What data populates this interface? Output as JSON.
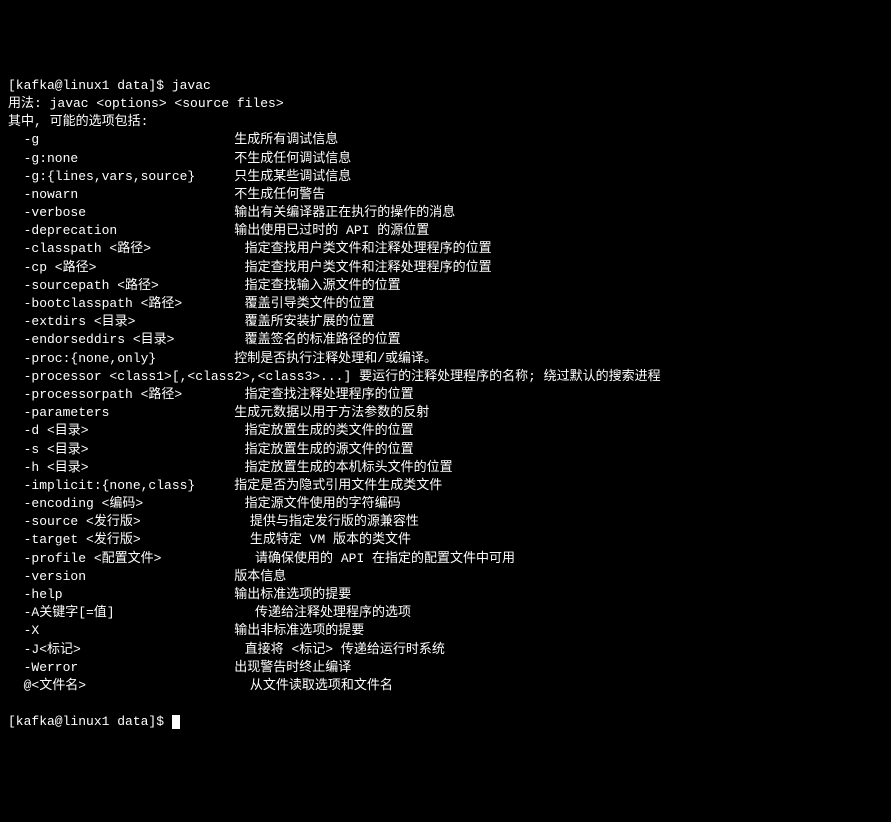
{
  "prompt1": {
    "full": "[kafka@linux1 data]$ ",
    "command": "javac"
  },
  "usage_line": "用法: javac <options> <source files>",
  "header_line": "其中, 可能的选项包括:",
  "options": [
    {
      "flag": "  -g                         ",
      "desc": "生成所有调试信息"
    },
    {
      "flag": "  -g:none                    ",
      "desc": "不生成任何调试信息"
    },
    {
      "flag": "  -g:{lines,vars,source}     ",
      "desc": "只生成某些调试信息"
    },
    {
      "flag": "  -nowarn                    ",
      "desc": "不生成任何警告"
    },
    {
      "flag": "  -verbose                   ",
      "desc": "输出有关编译器正在执行的操作的消息"
    },
    {
      "flag": "  -deprecation               ",
      "desc": "输出使用已过时的 API 的源位置"
    },
    {
      "flag": "  -classpath <路径>            ",
      "desc": "指定查找用户类文件和注释处理程序的位置"
    },
    {
      "flag": "  -cp <路径>                   ",
      "desc": "指定查找用户类文件和注释处理程序的位置"
    },
    {
      "flag": "  -sourcepath <路径>           ",
      "desc": "指定查找输入源文件的位置"
    },
    {
      "flag": "  -bootclasspath <路径>        ",
      "desc": "覆盖引导类文件的位置"
    },
    {
      "flag": "  -extdirs <目录>              ",
      "desc": "覆盖所安装扩展的位置"
    },
    {
      "flag": "  -endorseddirs <目录>         ",
      "desc": "覆盖签名的标准路径的位置"
    },
    {
      "flag": "  -proc:{none,only}          ",
      "desc": "控制是否执行注释处理和/或编译。"
    },
    {
      "flag": "  -processor <class1>[,<class2>,<class3>...] ",
      "desc": "要运行的注释处理程序的名称; 绕过默认的搜索进程"
    },
    {
      "flag": "  -processorpath <路径>        ",
      "desc": "指定查找注释处理程序的位置"
    },
    {
      "flag": "  -parameters                ",
      "desc": "生成元数据以用于方法参数的反射"
    },
    {
      "flag": "  -d <目录>                    ",
      "desc": "指定放置生成的类文件的位置"
    },
    {
      "flag": "  -s <目录>                    ",
      "desc": "指定放置生成的源文件的位置"
    },
    {
      "flag": "  -h <目录>                    ",
      "desc": "指定放置生成的本机标头文件的位置"
    },
    {
      "flag": "  -implicit:{none,class}     ",
      "desc": "指定是否为隐式引用文件生成类文件"
    },
    {
      "flag": "  -encoding <编码>             ",
      "desc": "指定源文件使用的字符编码"
    },
    {
      "flag": "  -source <发行版>              ",
      "desc": "提供与指定发行版的源兼容性"
    },
    {
      "flag": "  -target <发行版>              ",
      "desc": "生成特定 VM 版本的类文件"
    },
    {
      "flag": "  -profile <配置文件>            ",
      "desc": "请确保使用的 API 在指定的配置文件中可用"
    },
    {
      "flag": "  -version                   ",
      "desc": "版本信息"
    },
    {
      "flag": "  -help                      ",
      "desc": "输出标准选项的提要"
    },
    {
      "flag": "  -A关键字[=值]                  ",
      "desc": "传递给注释处理程序的选项"
    },
    {
      "flag": "  -X                         ",
      "desc": "输出非标准选项的提要"
    },
    {
      "flag": "  -J<标记>                     ",
      "desc": "直接将 <标记> 传递给运行时系统"
    },
    {
      "flag": "  -Werror                    ",
      "desc": "出现警告时终止编译"
    },
    {
      "flag": "  @<文件名>                     ",
      "desc": "从文件读取选项和文件名"
    }
  ],
  "prompt2": {
    "full": "[kafka@linux1 data]$ "
  }
}
